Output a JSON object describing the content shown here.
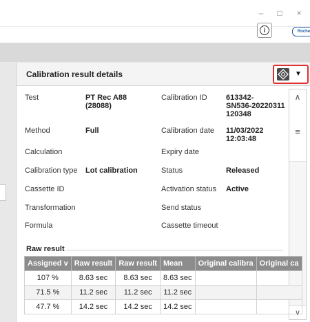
{
  "window": {
    "minimize_label": "–",
    "maximize_label": "□",
    "close_label": "×"
  },
  "toolbar": {
    "info_label": "i",
    "logo_text": "Roche"
  },
  "panel": {
    "title": "Calibration result details",
    "dropdown_label": "▼",
    "icons": {
      "nav": "diamond-arrows-icon",
      "dropdown": "caret-down-icon"
    }
  },
  "details": {
    "test_label": "Test",
    "test_value_line1": "PT Rec A88",
    "test_value_line2": "(28088)",
    "method_label": "Method",
    "method_value": "Full",
    "calculation_label": "Calculation",
    "calibration_type_label": "Calibration type",
    "calibration_type_value": "Lot calibration",
    "cassette_id_label": "Cassette ID",
    "transformation_label": "Transformation",
    "formula_label": "Formula",
    "calibration_id_label": "Calibration ID",
    "calibration_id_value_line1": "613342-",
    "calibration_id_value_line2": "SN536-20220311",
    "calibration_id_value_line3": "120348",
    "calibration_date_label": "Calibration date",
    "calibration_date_value_line1": "11/03/2022",
    "calibration_date_value_line2": "12:03:48",
    "expiry_date_label": "Expiry date",
    "status_label": "Status",
    "status_value": "Released",
    "activation_status_label": "Activation status",
    "activation_status_value": "Active",
    "send_status_label": "Send status",
    "cassette_timeout_label": "Cassette timeout"
  },
  "scroll": {
    "up_label": "∧",
    "menu_label": "≡",
    "down_label": "∨"
  },
  "raw_result": {
    "title": "Raw result",
    "headers": [
      "Assigned v",
      "Raw result",
      "Raw result",
      "Mean",
      "Original calibra",
      "Original ca"
    ],
    "rows": [
      [
        "107 %",
        "8.63 sec",
        "8.63 sec",
        "8.63 sec",
        "",
        ""
      ],
      [
        "71.5 %",
        "11.2 sec",
        "11.2 sec",
        "11.2 sec",
        "",
        ""
      ],
      [
        "47.7 %",
        "14.2 sec",
        "14.2 sec",
        "14.2 sec",
        "",
        ""
      ]
    ]
  }
}
